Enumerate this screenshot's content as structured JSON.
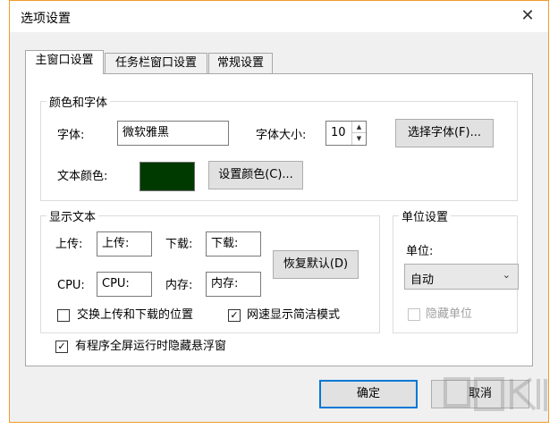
{
  "window": {
    "title": "选项设置",
    "close_glyph": "✕"
  },
  "tabs": [
    {
      "label": "主窗口设置"
    },
    {
      "label": "任务栏窗口设置"
    },
    {
      "label": "常规设置"
    }
  ],
  "color_font_group": {
    "title": "颜色和字体",
    "font_label": "字体:",
    "font_value": "微软雅黑",
    "font_size_label": "字体大小:",
    "font_size_value": "10",
    "choose_font_button": "选择字体(F)...",
    "text_color_label": "文本颜色:",
    "text_color_value": "#003a00",
    "set_color_button": "设置颜色(C)..."
  },
  "display_text_group": {
    "title": "显示文本",
    "upload_label": "上传:",
    "upload_value": "上传:",
    "download_label": "下载:",
    "download_value": "下载:",
    "cpu_label": "CPU:",
    "cpu_value": "CPU:",
    "memory_label": "内存:",
    "memory_value": "内存:",
    "restore_default_button": "恢复默认(D)",
    "swap_checkbox": {
      "label": "交换上传和下载的位置",
      "checked": false
    },
    "simple_mode_checkbox": {
      "label": "网速显示简洁模式",
      "checked": true
    }
  },
  "unit_group": {
    "title": "单位设置",
    "unit_label": "单位:",
    "unit_selected": "自动",
    "hide_unit_checkbox": {
      "label": "隐藏单位",
      "checked": false,
      "disabled": true
    }
  },
  "fullscreen_hide_checkbox": {
    "label": "有程序全屏运行时隐藏悬浮窗",
    "checked": true
  },
  "buttons": {
    "ok": "确定",
    "cancel": "取消"
  },
  "check_glyph": "✓",
  "spin_up_glyph": "▲",
  "spin_down_glyph": "▼",
  "combo_arrow_glyph": "⌄",
  "colors": {
    "title_border": "#f29b2c",
    "focus_border": "#0078d7"
  }
}
